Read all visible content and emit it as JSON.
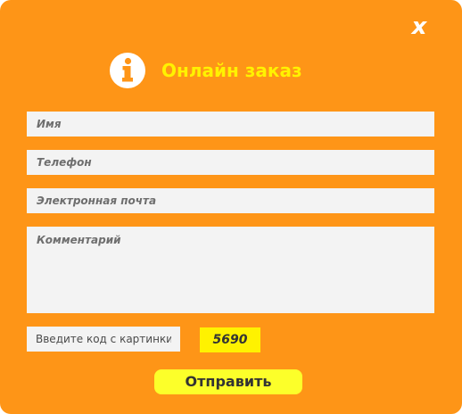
{
  "dialog": {
    "close_label": "x",
    "title": "Онлайн заказ",
    "icon": "info-icon"
  },
  "form": {
    "name_placeholder": "Имя",
    "phone_placeholder": "Телефон",
    "email_placeholder": "Электронная почта",
    "comment_placeholder": "Комментарий",
    "captcha_placeholder": "Введите код с картинки",
    "captcha_code": "5690",
    "submit_label": "Отправить"
  },
  "colors": {
    "background": "#fe9517",
    "title": "#fff200",
    "field": "#f3f3f3",
    "button": "#fcff2a",
    "captcha_bg": "#fff200"
  }
}
